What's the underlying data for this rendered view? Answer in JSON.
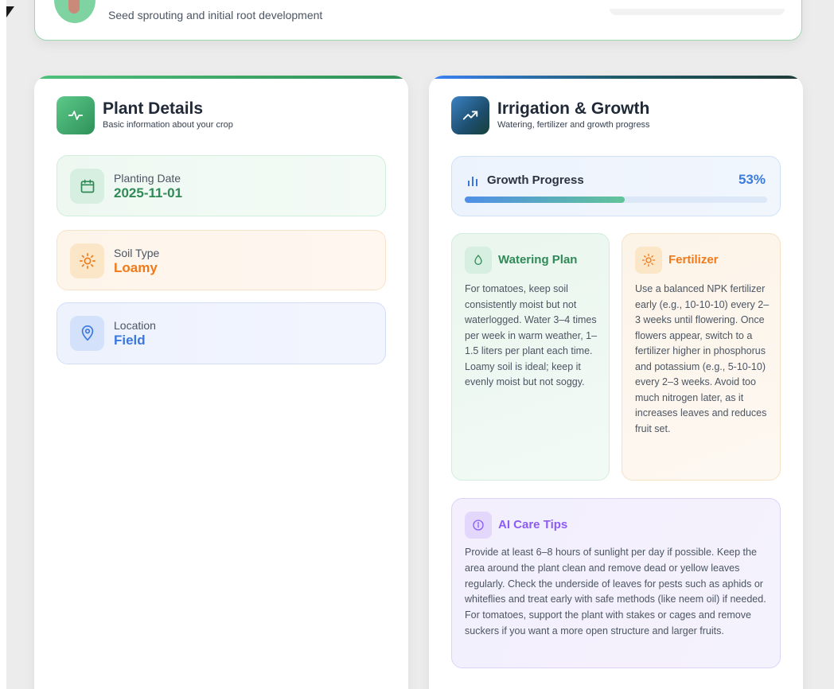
{
  "stage": {
    "description": "Seed sprouting and initial root development"
  },
  "plant_details": {
    "title": "Plant Details",
    "subtitle": "Basic information about your crop",
    "planting_date": {
      "label": "Planting Date",
      "value": "2025-11-01",
      "icon": "calendar-icon"
    },
    "soil_type": {
      "label": "Soil Type",
      "value": "Loamy",
      "icon": "sun-icon"
    },
    "location": {
      "label": "Location",
      "value": "Field",
      "icon": "location-pin-icon"
    }
  },
  "irrigation": {
    "title": "Irrigation & Growth",
    "subtitle": "Watering, fertilizer and growth progress",
    "growth": {
      "label": "Growth Progress",
      "percent_text": "53%",
      "percent": 53
    },
    "watering": {
      "title": "Watering Plan",
      "text": "For tomatoes, keep soil consistently moist but not waterlogged. Water 3–4 times per week in warm weather, 1–1.5 liters per plant each time. Loamy soil is ideal; keep it evenly moist but not soggy."
    },
    "fertilizer": {
      "title": "Fertilizer",
      "text": "Use a balanced NPK fertilizer early (e.g., 10-10-10) every 2–3 weeks until flowering. Once flowers appear, switch to a fertilizer higher in phosphorus and potassium (e.g., 5-10-10) every 2–3 weeks. Avoid too much nitrogen later, as it increases leaves and reduces fruit set."
    },
    "ai_tips": {
      "title": "AI Care Tips",
      "text": "Provide at least 6–8 hours of sunlight per day if possible. Keep the area around the plant clean and remove dead or yellow leaves regularly. Check the underside of leaves for pests such as aphids or whiteflies and treat early with safe methods (like neem oil) if needed. For tomatoes, support the plant with stakes or cages and remove suckers if you want a more open structure and larger fruits."
    }
  },
  "colors": {
    "green_accent": "#2f8a57",
    "orange_accent": "#f07a1a",
    "blue_accent": "#3a78e0",
    "purple_accent": "#8b5cf6"
  }
}
